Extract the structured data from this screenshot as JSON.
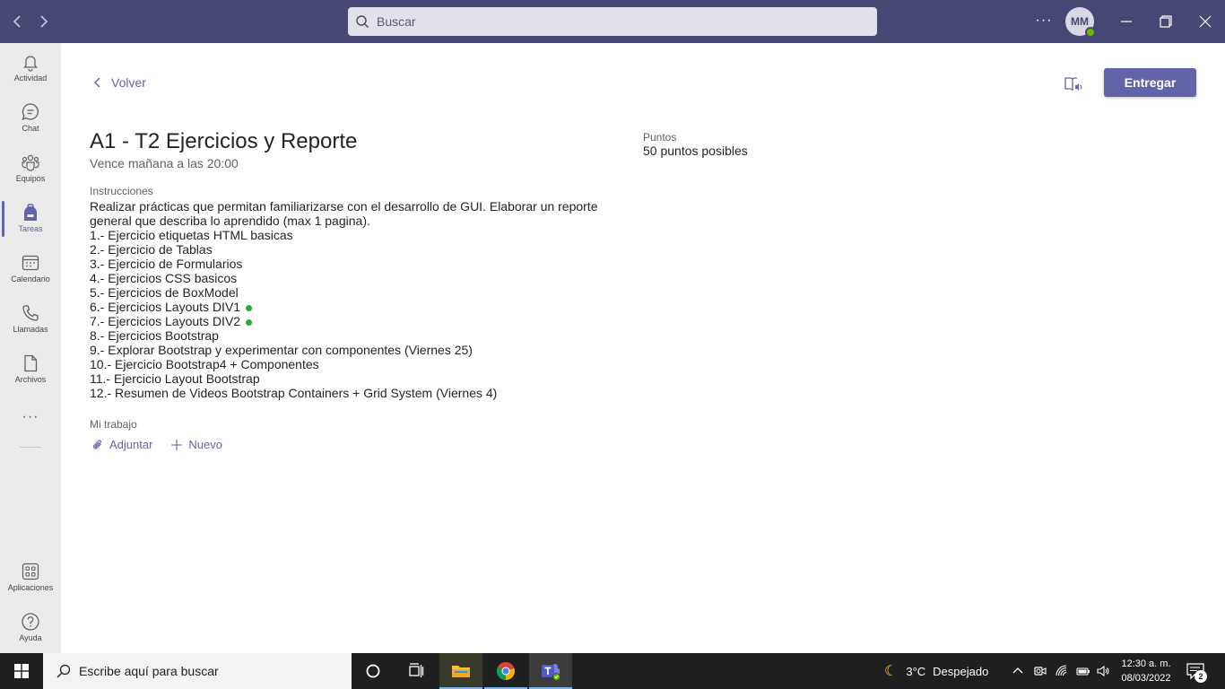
{
  "titlebar": {
    "search_placeholder": "Buscar",
    "avatar_initials": "MM",
    "more_label": "···"
  },
  "rail": {
    "items": [
      {
        "label": "Actividad",
        "icon": "bell-icon"
      },
      {
        "label": "Chat",
        "icon": "chat-icon"
      },
      {
        "label": "Equipos",
        "icon": "teams-icon"
      },
      {
        "label": "Tareas",
        "icon": "backpack-icon",
        "active": true
      },
      {
        "label": "Calendario",
        "icon": "calendar-icon"
      },
      {
        "label": "Llamadas",
        "icon": "phone-icon"
      },
      {
        "label": "Archivos",
        "icon": "file-icon"
      }
    ],
    "more_label": "···",
    "bottom": [
      {
        "label": "Aplicaciones",
        "icon": "apps-icon"
      },
      {
        "label": "Ayuda",
        "icon": "help-icon"
      }
    ]
  },
  "assignment": {
    "back_label": "Volver",
    "submit_label": "Entregar",
    "title": "A1 - T2 Ejercicios y Reporte",
    "due": "Vence mañana a las 20:00",
    "points_label": "Puntos",
    "points_value": "50 puntos posibles",
    "instructions_label": "Instrucciones",
    "instructions": [
      "Realizar prácticas que permitan familiarizarse con el desarrollo de GUI. Elaborar un reporte",
      "general que describa lo aprendido (max 1 pagina).",
      "1.- Ejercicio etiquetas HTML basicas",
      "2.- Ejercicio de Tablas",
      "3.- Ejercicio de Formularios",
      "4.- Ejercicios CSS basicos",
      "5.- Ejercicios de BoxModel",
      "6.- Ejercicios Layouts DIV1",
      "7.- Ejercicios Layouts DIV2",
      "8.- Ejercicios Bootstrap",
      "9.- Explorar Bootstrap y experimentar con componentes (Viernes 25)",
      "10.- Ejercicio Bootstrap4 + Componentes",
      "11.- Ejercicio Layout Bootstrap",
      "12.- Resumen de Videos Bootstrap Containers + Grid System (Viernes 4)"
    ],
    "my_work_label": "Mi trabajo",
    "attach_label": "Adjuntar",
    "new_label": "Nuevo"
  },
  "taskbar": {
    "search_placeholder": "Escribe aquí para buscar",
    "weather_temp": "3°C",
    "weather_desc": "Despejado",
    "time": "12:30 a. m.",
    "date": "08/03/2022",
    "notification_count": "2"
  },
  "colors": {
    "titlebar": "#464775",
    "accent": "#6264a7",
    "rail": "#ebebeb",
    "taskbar": "#1f1f1f",
    "status_green": "#27a844"
  }
}
